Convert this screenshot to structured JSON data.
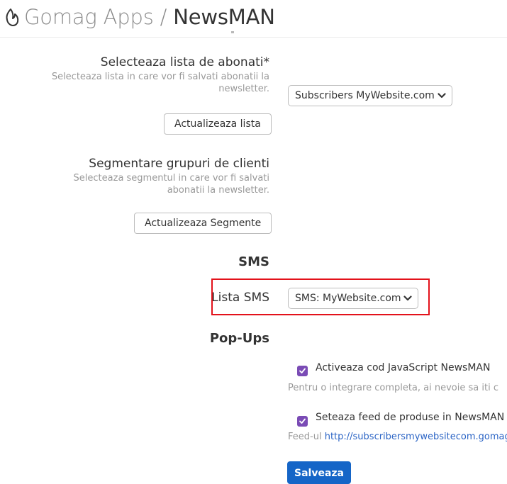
{
  "header": {
    "app_name": "Gomag Apps",
    "separator": " / ",
    "page_name": "NewsMAN"
  },
  "subscribers": {
    "label": "Selecteaza lista de abonati*",
    "help_line1": "Selecteaza lista in care vor fi salvati abonatii la",
    "help_line2": "newsletter.",
    "selected": "Subscribers MyWebsite.com",
    "update_button": "Actualizeaza lista"
  },
  "segments": {
    "label": "Segmentare grupuri de clienti",
    "help_line1": "Selecteaza segmentul in care vor fi salvati",
    "help_line2": "abonatii la newsletter.",
    "update_button": "Actualizeaza Segmente"
  },
  "sms": {
    "heading": "SMS",
    "list_label": "Lista SMS",
    "selected": "SMS: MyWebsite.com"
  },
  "popups": {
    "heading": "Pop-Ups",
    "js_checkbox_label": "Activeaza cod JavaScript NewsMAN",
    "js_checked": true,
    "js_help": "Pentru o integrare completa, ai nevoie sa iti c",
    "feed_checkbox_label": "Seteaza feed de produse in NewsMAN",
    "feed_checked": true,
    "feed_help_prefix": "Feed-ul ",
    "feed_link": "http://subscribersmywebsitecom.gomag"
  },
  "actions": {
    "save": "Salveaza"
  },
  "colors": {
    "accent": "#1565c7",
    "checkbox": "#7a4bb5",
    "highlight": "#e3121b",
    "link": "#2b64c5"
  },
  "icons": {
    "logo": "flame-icon",
    "select_arrow": "chevron-down-icon",
    "checkbox_mark": "check-icon"
  }
}
